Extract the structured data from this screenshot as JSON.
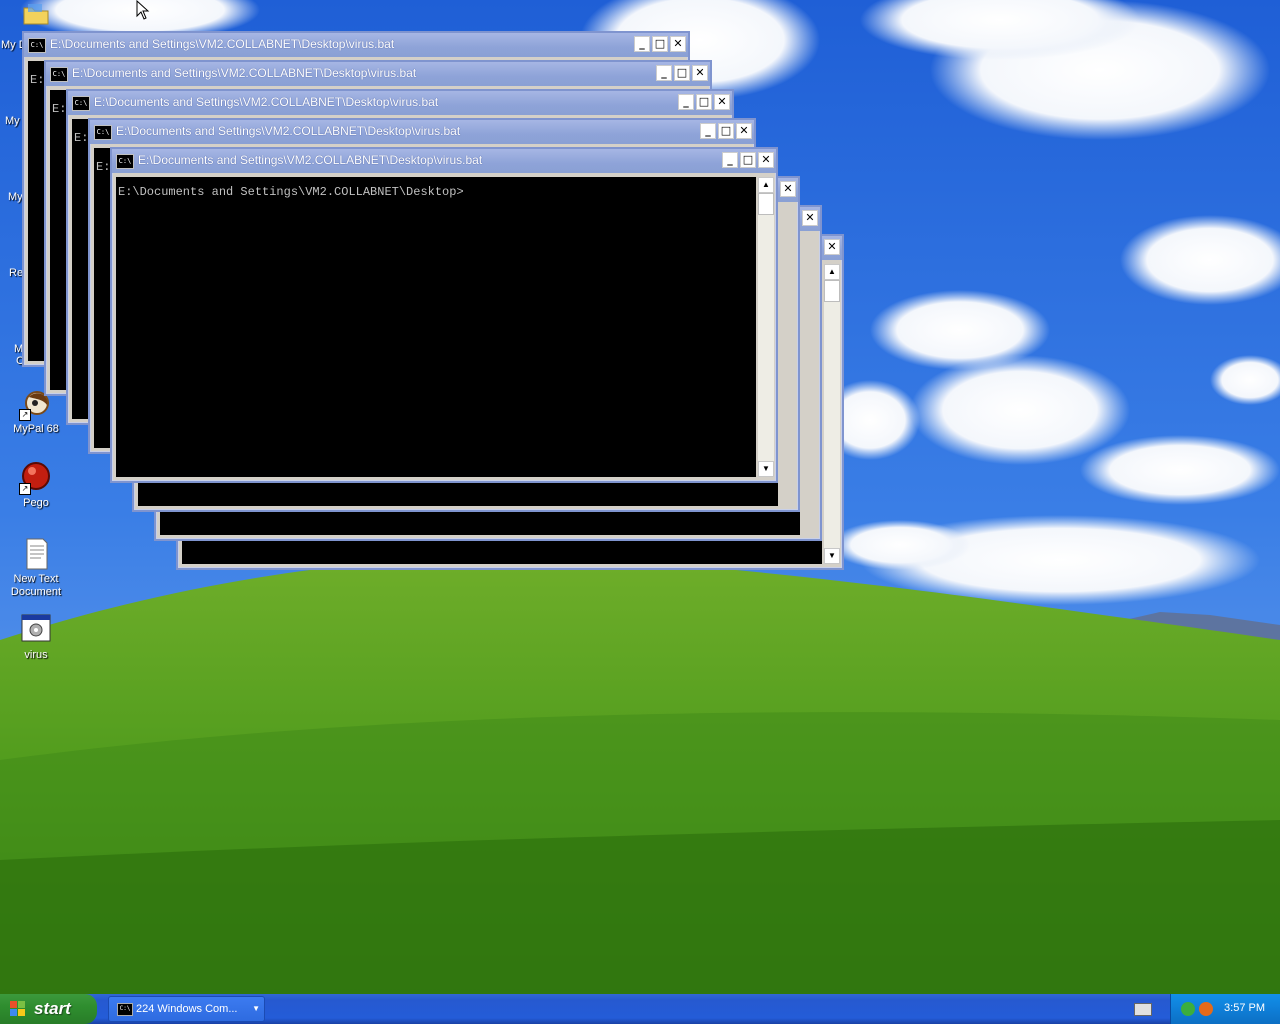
{
  "desktop": {
    "edge_labels": [
      "My D",
      "My",
      "My",
      "Re",
      "M",
      "C"
    ],
    "icons": [
      {
        "name": "mypal-icon",
        "label": "MyPal 68"
      },
      {
        "name": "pego-icon",
        "label": "Pego"
      },
      {
        "name": "text-document-icon",
        "label": "New Text Document"
      },
      {
        "name": "batch-file-icon",
        "label": "virus"
      }
    ]
  },
  "windows": {
    "title": "E:\\Documents and Settings\\VM2.COLLABNET\\Desktop\\virus.bat",
    "icon_text": "C:\\",
    "prompt": "E:\\Documents and Settings\\VM2.COLLABNET\\Desktop>",
    "side_prompt_char": "E:",
    "buttons": {
      "minimize": "_",
      "maximize": "□",
      "close": "✕"
    }
  },
  "taskbar": {
    "start_label": "start",
    "task_label": "224 Windows Com...",
    "clock": "3:57 PM"
  }
}
